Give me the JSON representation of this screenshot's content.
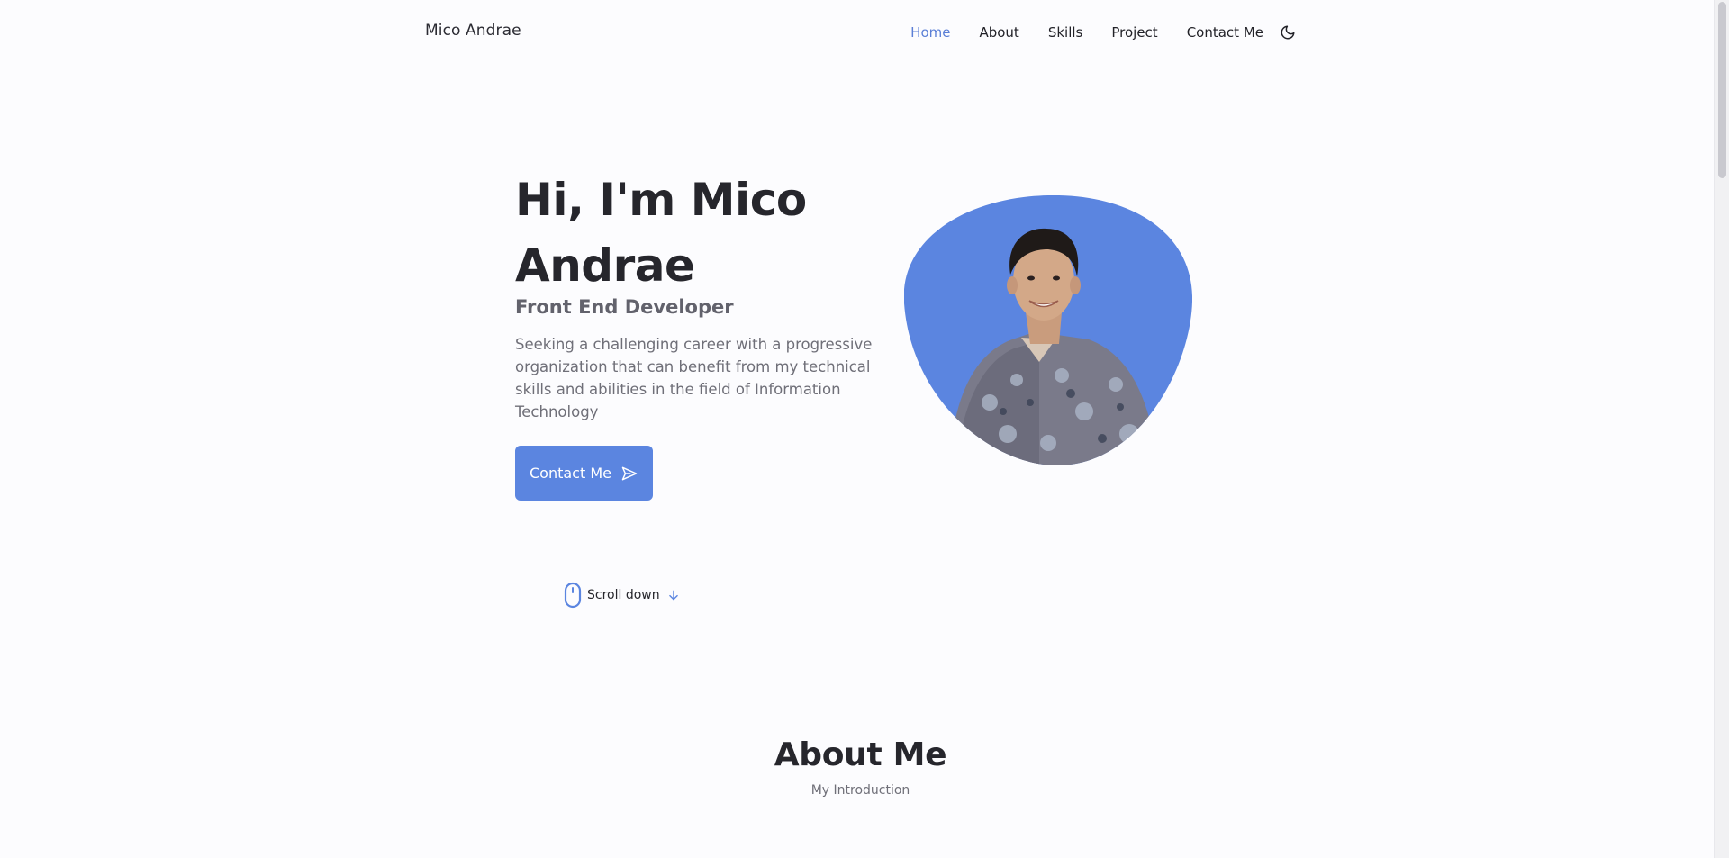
{
  "header": {
    "logo": "Mico Andrae",
    "nav": {
      "home": "Home",
      "about": "About",
      "skills": "Skills",
      "project": "Project",
      "contact": "Contact Me"
    },
    "theme_icon": "moon-icon"
  },
  "hero": {
    "title_line1": "Hi, I'm Mico",
    "title_line2": "Andrae",
    "subtitle": "Front End Developer",
    "description": "Seeking a challenging career with a progressive organization that can benefit from my technical skills and abilities in the field of Information Technology",
    "button_label": "Contact Me",
    "button_icon": "send-icon",
    "photo_icon": "profile-photo",
    "blob_color": "#5b85e0"
  },
  "scroll": {
    "label": "Scroll down",
    "mouse_icon": "mouse-icon",
    "arrow_icon": "arrow-down-icon"
  },
  "about": {
    "title": "About Me",
    "subtitle": "My Introduction"
  },
  "colors": {
    "accent": "#5b85e0",
    "nav_active": "#5b7fd6",
    "background": "#fcfcfe",
    "title": "#26262c",
    "text": "#6f6f78"
  }
}
